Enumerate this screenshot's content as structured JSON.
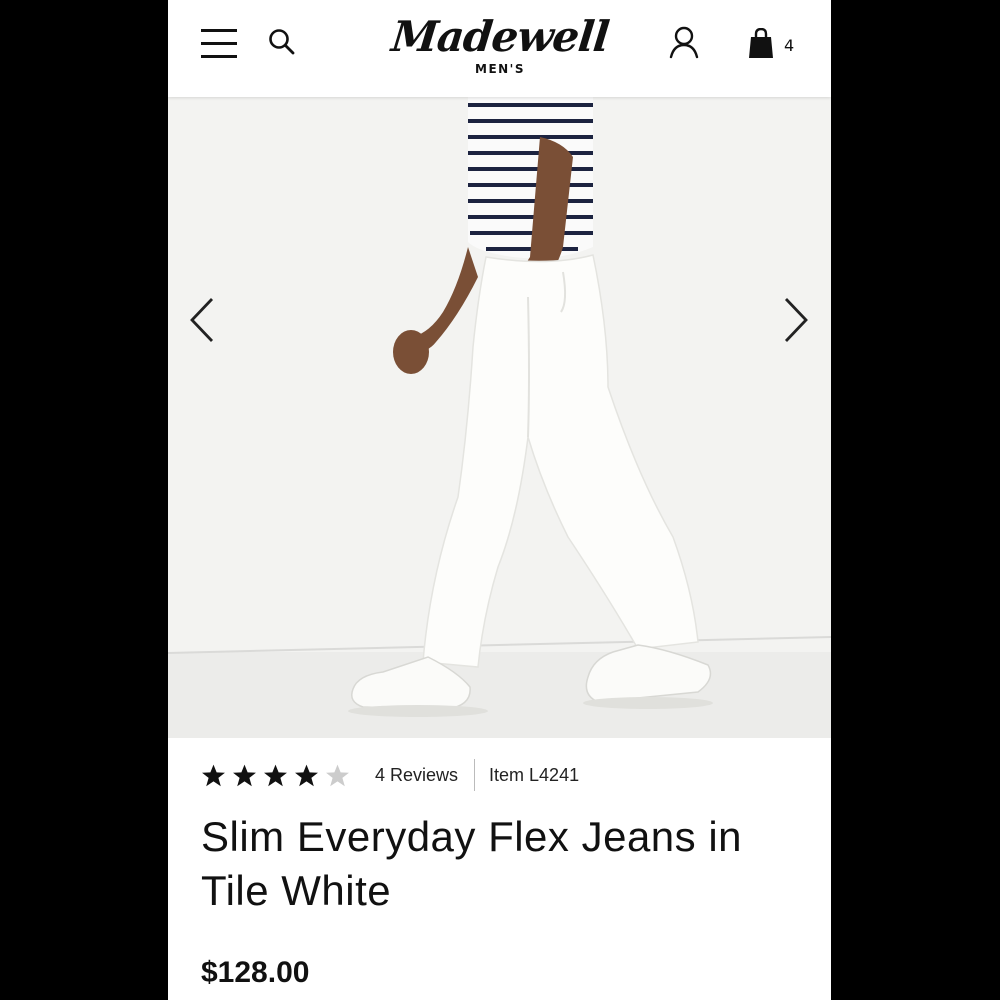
{
  "header": {
    "logo_text": "Madewell",
    "logo_sub": "MEN'S",
    "bag_count": "4",
    "icons": [
      "menu-icon",
      "search-icon",
      "account-icon",
      "shopping-bag-icon"
    ]
  },
  "carousel": {
    "image_alt": "Model wearing white slim jeans, striped tee and white sneakers",
    "prev_icon": "chevron-left-icon",
    "next_icon": "chevron-right-icon"
  },
  "product": {
    "rating": 4,
    "rating_max": 5,
    "reviews_label": "4 Reviews",
    "item_label": "Item L4241",
    "title": "Slim Everyday Flex Jeans in Tile White",
    "price": "$128.00"
  },
  "colors": {
    "text": "#111111",
    "star_filled": "#111111",
    "star_empty": "#cccccc",
    "background": "#000000"
  }
}
